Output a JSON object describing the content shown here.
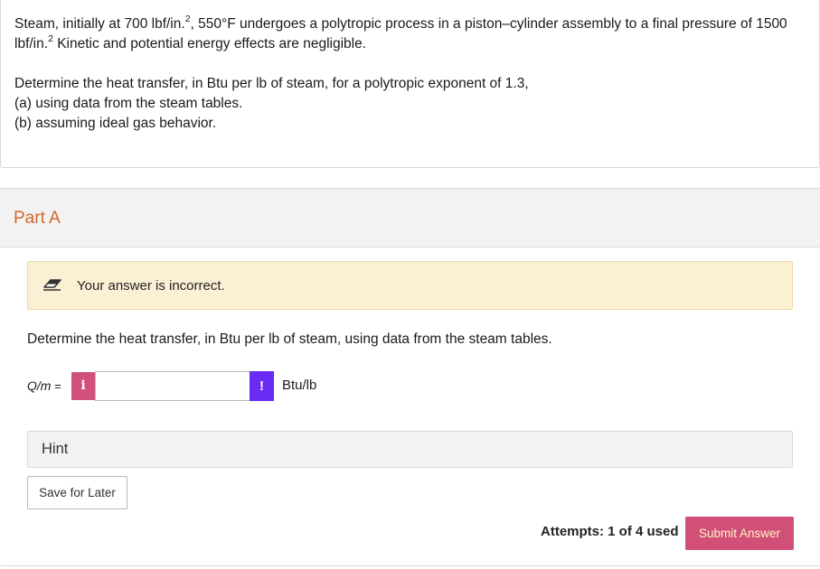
{
  "problem": {
    "line1_a": "Steam, initially at 700 lbf/in.",
    "line1_sup": "2",
    "line1_b": ", 550°F undergoes a polytropic process in a piston–cylinder assembly to a final pressure of 1500",
    "line2_a": "lbf/in.",
    "line2_sup": "2",
    "line2_b": " Kinetic and potential energy effects are negligible.",
    "line3": "Determine the heat transfer, in Btu per lb of steam, for a polytropic exponent of 1.3,",
    "line4": "(a) using data from the steam tables.",
    "line5": "(b) assuming ideal gas behavior."
  },
  "part": {
    "title": "Part A",
    "title_color": "#d1682b"
  },
  "feedback": {
    "icon": "eraser-icon",
    "text": "Your answer is incorrect."
  },
  "question": {
    "text": "Determine the heat transfer, in Btu per lb of steam, using data from the steam tables."
  },
  "answer": {
    "label": "Q/m",
    "equals": " =",
    "info_icon": "i",
    "value": "",
    "error_icon": "!",
    "unit": "Btu/lb"
  },
  "hint": {
    "label": "Hint"
  },
  "buttons": {
    "save": "Save for Later",
    "submit": "Submit Answer"
  },
  "attempts": {
    "label": "Attempts:",
    "value": "1 of 4 used"
  },
  "colors": {
    "info": "#d1517a",
    "error": "#6a2cf5",
    "submit": "#d24f78",
    "feedback_bg": "#fbf0d4"
  }
}
